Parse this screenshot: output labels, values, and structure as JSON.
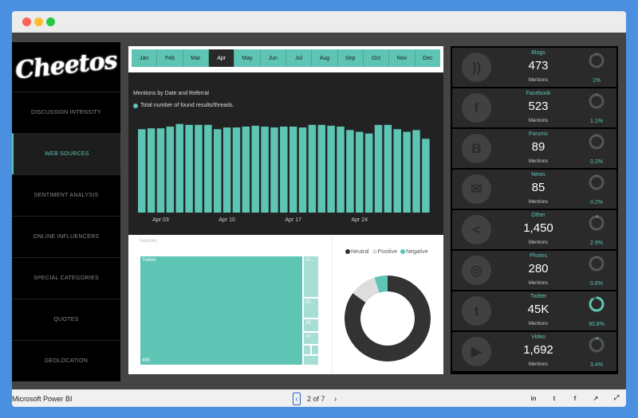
{
  "app": {
    "brand": "Microsoft Power BI"
  },
  "logo": {
    "text": "Cheetos"
  },
  "sidebar": {
    "items": [
      {
        "label": "DISCUSSION INTENSITY",
        "active": false
      },
      {
        "label": "WEB SOURCES",
        "active": true
      },
      {
        "label": "SENTIMENT ANALYSIS",
        "active": false
      },
      {
        "label": "ONLINE INFLUENCERS",
        "active": false
      },
      {
        "label": "SPECIAL CATEGORIES",
        "active": false
      },
      {
        "label": "QUOTES",
        "active": false
      },
      {
        "label": "GEOLOCATION",
        "active": false
      }
    ]
  },
  "months": [
    "Jan",
    "Feb",
    "Mar",
    "Apr",
    "May",
    "Jun",
    "Jul",
    "Aug",
    "Sep",
    "Oct",
    "Nov",
    "Dec"
  ],
  "selected_month": "Apr",
  "mentions_chart": {
    "title": "Mentions by Date and Referral",
    "legend": "Total number of found results/threads."
  },
  "chart_data": [
    {
      "type": "bar",
      "title": "Mentions by Date and Referral",
      "series": [
        {
          "name": "Total number of found results/threads.",
          "values": [
            96,
            97,
            97,
            99,
            102,
            101,
            101,
            101,
            96,
            98,
            98,
            99,
            100,
            99,
            98,
            99,
            99,
            98,
            101,
            101,
            100,
            99,
            95,
            93,
            91,
            101,
            101,
            96,
            93,
            95,
            85
          ]
        }
      ],
      "x_ticks": [
        "Apr 03",
        "Apr 10",
        "Apr 17",
        "Apr 24"
      ],
      "x_tick_days": [
        3,
        10,
        17,
        24
      ],
      "x_days": [
        1,
        2,
        3,
        4,
        5,
        6,
        7,
        8,
        9,
        10,
        11,
        12,
        13,
        14,
        15,
        16,
        17,
        18,
        19,
        20,
        21,
        22,
        23,
        24,
        25,
        26,
        27,
        28,
        29,
        30,
        31
      ],
      "ylim": [
        0,
        110
      ],
      "grid": false,
      "color": "#5ec4b4"
    },
    {
      "type": "pie",
      "legend": [
        "Neutral",
        "Positive",
        "Negative"
      ],
      "values": [
        85,
        10,
        5
      ],
      "colors": [
        "#333333",
        "#dddddd",
        "#5ec4b4"
      ],
      "donut": true
    }
  ],
  "sources_treemap": {
    "title": "Sources",
    "items": [
      {
        "label": "Twitter",
        "value": "45K"
      },
      {
        "label": "Vi..."
      },
      {
        "label": "Ot..."
      },
      {
        "label": "2K"
      },
      {
        "label": "1K"
      }
    ]
  },
  "sentiment_legend": {
    "neutral": "Neutral",
    "positive": "Positive",
    "negative": "Negative"
  },
  "metrics": [
    {
      "label": "Blogs",
      "value": "473",
      "sub": "Mentions",
      "pct": "1%",
      "fraction": 0.01,
      "icon": "rss-icon"
    },
    {
      "label": "Facebook",
      "value": "523",
      "sub": "Mentions",
      "pct": "1.1%",
      "fraction": 0.011,
      "icon": "facebook-icon"
    },
    {
      "label": "Forums",
      "value": "89",
      "sub": "Mentions",
      "pct": "0.2%",
      "fraction": 0.002,
      "icon": "blogger-icon"
    },
    {
      "label": "News",
      "value": "85",
      "sub": "Mentions",
      "pct": "0.2%",
      "fraction": 0.002,
      "icon": "mail-icon"
    },
    {
      "label": "Other",
      "value": "1,450",
      "sub": "Mentions",
      "pct": "2.9%",
      "fraction": 0.029,
      "icon": "share-icon"
    },
    {
      "label": "Photos",
      "value": "280",
      "sub": "Mentions",
      "pct": "0.6%",
      "fraction": 0.006,
      "icon": "instagram-icon"
    },
    {
      "label": "Twitter",
      "value": "45K",
      "sub": "Mentions",
      "pct": "90.8%",
      "fraction": 0.908,
      "icon": "twitter-icon"
    },
    {
      "label": "Video",
      "value": "1,692",
      "sub": "Mentions",
      "pct": "3.4%",
      "fraction": 0.034,
      "icon": "play-icon"
    }
  ],
  "pager": {
    "text": "2 of 7",
    "prev": "‹",
    "next": "›"
  },
  "share_icons": [
    "linkedin-icon",
    "twitter-icon",
    "facebook-icon",
    "share-icon",
    "fullscreen-icon"
  ],
  "colors": {
    "accent": "#5ec4b4",
    "dark": "#222222",
    "panel": "#2a2a2a"
  }
}
